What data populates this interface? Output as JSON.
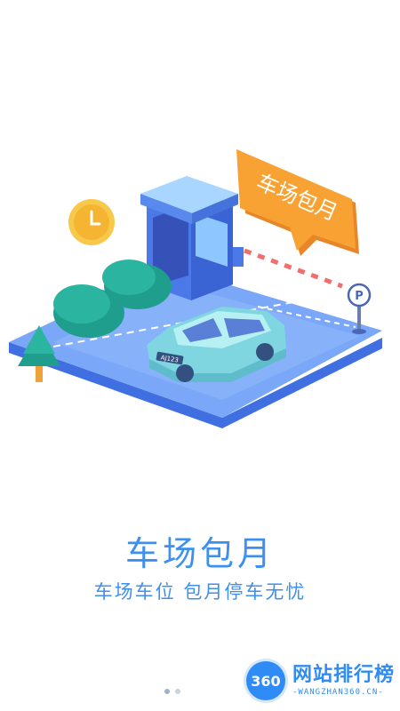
{
  "sign": {
    "text": "车场包月"
  },
  "car": {
    "plate": "AJ123"
  },
  "parking_sign": {
    "letter": "P"
  },
  "headline": "车场包月",
  "subheadline": "车场车位  包月停车无忧",
  "pager": {
    "total": 2,
    "active": 1
  },
  "watermark": {
    "badge": "360",
    "title": "网站排行榜",
    "subtitle": "-WANGZHAN360.CN-"
  },
  "colors": {
    "accent": "#3d8ff0",
    "sign_orange": "#f7a233",
    "platform": "#6f9ff5"
  }
}
